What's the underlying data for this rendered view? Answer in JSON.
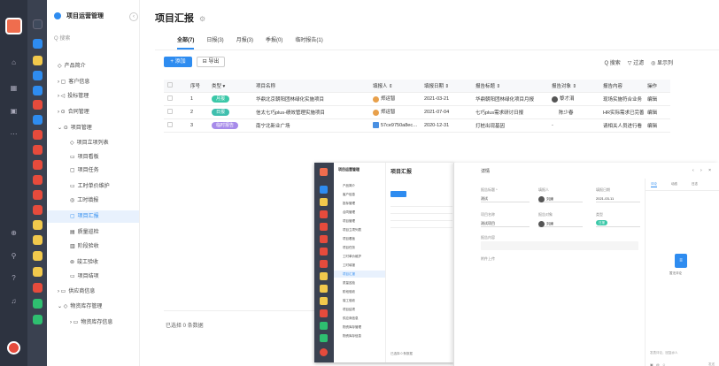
{
  "colors": {
    "accent": "#2e8cf0",
    "rail": "#2d3340",
    "green": "#3bc8a8",
    "purple": "#a78bea"
  },
  "rail": {
    "icons": [
      "home-icon",
      "grid-icon",
      "doc-icon",
      "more-icon",
      "add-icon",
      "search-icon",
      "help-icon",
      "bell-icon"
    ]
  },
  "sidebar": {
    "title": "项目运营管理",
    "search_placeholder": "搜索",
    "items": [
      {
        "label": "产品简介",
        "level": 0,
        "prefix": "◇"
      },
      {
        "label": "客户信息",
        "level": 0,
        "prefix": "›  ▢"
      },
      {
        "label": "投标管理",
        "level": 0,
        "prefix": "›  ◁"
      },
      {
        "label": "合同管理",
        "level": 0,
        "prefix": "›  ⊙"
      },
      {
        "label": "项目管理",
        "level": 0,
        "prefix": "⌄  ⊙"
      },
      {
        "label": "项目立项列表",
        "level": 1,
        "prefix": "◇"
      },
      {
        "label": "项目看板",
        "level": 1,
        "prefix": "▭"
      },
      {
        "label": "项目任务",
        "level": 1,
        "prefix": "▢"
      },
      {
        "label": "工时单价维护",
        "level": 1,
        "prefix": "▭"
      },
      {
        "label": "工时填报",
        "level": 1,
        "prefix": "◎"
      },
      {
        "label": "项目汇报",
        "level": 1,
        "prefix": "▢",
        "active": true
      },
      {
        "label": "质量巡检",
        "level": 1,
        "prefix": "▤"
      },
      {
        "label": "阶段验收",
        "level": 1,
        "prefix": "▥"
      },
      {
        "label": "竣工验收",
        "level": 1,
        "prefix": "⊚"
      },
      {
        "label": "项目结项",
        "level": 1,
        "prefix": "▭"
      },
      {
        "label": "供应商信息",
        "level": 0,
        "prefix": "›  ▭"
      },
      {
        "label": "物资库存管理",
        "level": 0,
        "prefix": "⌄  ◇"
      },
      {
        "label": "物资库存信息",
        "level": 1,
        "prefix": "›  ▭"
      }
    ]
  },
  "main": {
    "title": "项目汇报",
    "tabs": [
      {
        "label": "全部(7)",
        "active": true
      },
      {
        "label": "日报(3)"
      },
      {
        "label": "月报(3)"
      },
      {
        "label": "季报(0)"
      },
      {
        "label": "临时报告(1)"
      }
    ],
    "add_label": "+ 添加",
    "export_label": "⊟ 导出",
    "search_label": "Q 搜索",
    "filter_label": "▽ 过滤",
    "display_label": "◎ 显示列",
    "columns": [
      "",
      "序号",
      "类型 ▾",
      "项目名称",
      "填报人 ⇕",
      "填报日期 ⇕",
      "报告标题 ⇕",
      "报告对象 ⇕",
      "报告内容",
      "操作"
    ],
    "rows": [
      {
        "no": "1",
        "type": "月报",
        "type_color": "green",
        "project": "华鼎北京朝阳团林绿化实施项目",
        "reporter": "郑运智",
        "date": "2021-03-21",
        "title": "华鼎朝阳团林绿化项目月报",
        "target": "黎才涓",
        "content": "现场实施符合业务",
        "op": "编辑"
      },
      {
        "no": "2",
        "type": "日报",
        "type_color": "teal",
        "project": "信太七巧plus-绩效管理实施项目",
        "reporter": "郑运智",
        "date": "2021-07-04",
        "title": "七巧plus需求研讨日报",
        "target": "陈少春",
        "content": "HR实际需求已完善",
        "op": "编辑"
      },
      {
        "no": "3",
        "type": "临时报告",
        "type_color": "purple",
        "project": "南宁北新业广场",
        "reporter": "57ce9750a8ec…",
        "date": "2020-12-31",
        "title": "打桩出现基因",
        "target": "-",
        "content": "请相关人员进行看",
        "op": "编辑"
      }
    ],
    "footer": "已选择 0 条数据"
  },
  "overlay": {
    "sidebar_title": "项目运营管理",
    "title": "项目汇报",
    "items": [
      "产品简介",
      "客户信息",
      "投标管理",
      "合同管理",
      "项目管理",
      "项目立项列表",
      "项目看板",
      "项目任务",
      "工时单价维护",
      "工时填报",
      "项目汇报",
      "质量巡检",
      "阶段验收",
      "竣工验收",
      "项目结项",
      "供应商信息",
      "物资库存管理",
      "物资库存信息"
    ],
    "footer": "已选择 0 条数据"
  },
  "drawer": {
    "title": "详情",
    "nav": "‹ › ×",
    "fields": [
      {
        "label": "报告标题 *",
        "value": "测试"
      },
      {
        "label": "填报人",
        "value": "刘建"
      },
      {
        "label": "填报日期",
        "value": "2021-03-11"
      },
      {
        "label": "项目名称",
        "value": "测试项目"
      },
      {
        "label": "报告对象",
        "value": "刘建"
      },
      {
        "label": "类型",
        "value": "日报"
      },
      {
        "label": "报告内容",
        "value": ""
      },
      {
        "label": "附件上传",
        "value": ""
      }
    ],
    "right_tabs": [
      "评论",
      "动态",
      "日志"
    ],
    "doc_label": "暂无评论",
    "comment_placeholder": "发表评论，回复@人",
    "send_label": "发送"
  }
}
